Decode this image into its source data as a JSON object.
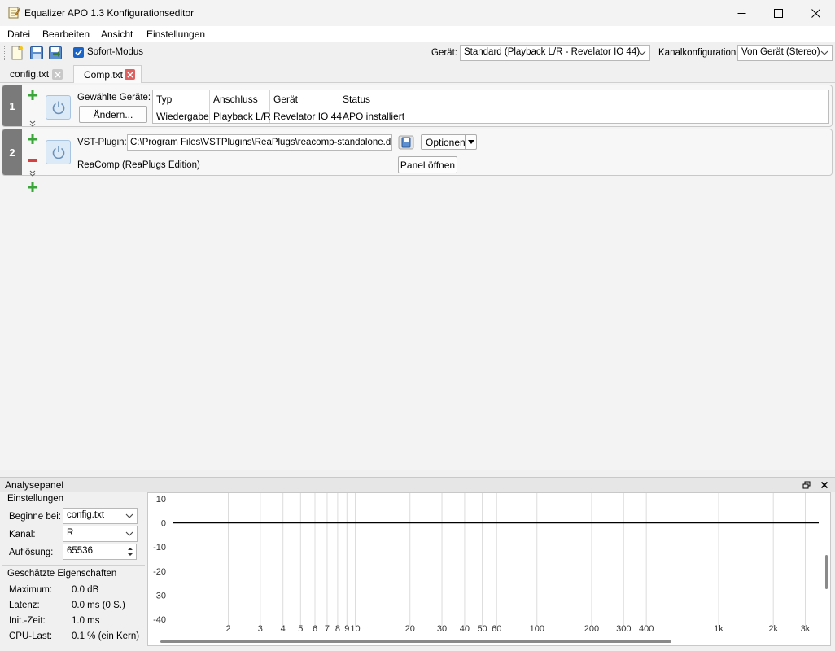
{
  "window": {
    "title": "Equalizer APO 1.3 Konfigurationseditor"
  },
  "menu": [
    "Datei",
    "Bearbeiten",
    "Ansicht",
    "Einstellungen"
  ],
  "toolbar": {
    "instant_mode_label": "Sofort-Modus",
    "instant_mode_checked": true,
    "device_label": "Gerät:",
    "device_value": "Standard (Playback L/R - Revelator IO 44)",
    "channel_config_label": "Kanalkonfiguration:",
    "channel_config_value": "Von Gerät (Stereo)"
  },
  "tabs": [
    {
      "label": "config.txt",
      "active": false
    },
    {
      "label": "Comp.txt",
      "active": true
    }
  ],
  "filters": [
    {
      "number": "1",
      "selected_devices_label": "Gewählte Geräte:",
      "change_button": "Ändern...",
      "table": {
        "headers": [
          "Typ",
          "Anschluss",
          "Gerät",
          "Status"
        ],
        "rows": [
          [
            "Wiedergabe",
            "Playback L/R",
            "Revelator IO 44",
            "APO installiert"
          ]
        ]
      }
    },
    {
      "number": "2",
      "vst_label": "VST-Plugin:",
      "vst_path": "C:\\Program Files\\VSTPlugins\\ReaPlugs\\reacomp-standalone.dll",
      "plugin_name": "ReaComp (ReaPlugs Edition)",
      "options_button": "Optionen",
      "open_panel_button": "Panel öffnen"
    }
  ],
  "analysis_panel": {
    "title": "Analysepanel",
    "settings_group": "Einstellungen",
    "start_at_label": "Beginne bei:",
    "start_at_value": "config.txt",
    "channel_label": "Kanal:",
    "channel_value": "R",
    "resolution_label": "Auflösung:",
    "resolution_value": "65536",
    "properties_group": "Geschätzte Eigenschaften",
    "properties": [
      {
        "label": "Maximum:",
        "value": "0.0 dB"
      },
      {
        "label": "Latenz:",
        "value": "0.0 ms (0 S.)"
      },
      {
        "label": "Init.-Zeit:",
        "value": "1.0 ms"
      },
      {
        "label": "CPU-Last:",
        "value": "0.1 % (ein Kern)"
      }
    ]
  },
  "chart_data": {
    "type": "line",
    "series": [
      {
        "x": [
          2,
          3000
        ],
        "y": [
          0,
          0
        ]
      }
    ],
    "x_scale": "log",
    "y_ticks": [
      "10",
      "0",
      "-10",
      "-20",
      "-30",
      "-40"
    ],
    "x_tick_labels": [
      "2",
      "3",
      "4",
      "5",
      "6",
      "7",
      "8",
      "9",
      "10",
      "20",
      "30",
      "40",
      "50",
      "60",
      "100",
      "200",
      "300",
      "400",
      "1k",
      "2k",
      "3k"
    ],
    "grid": true
  }
}
